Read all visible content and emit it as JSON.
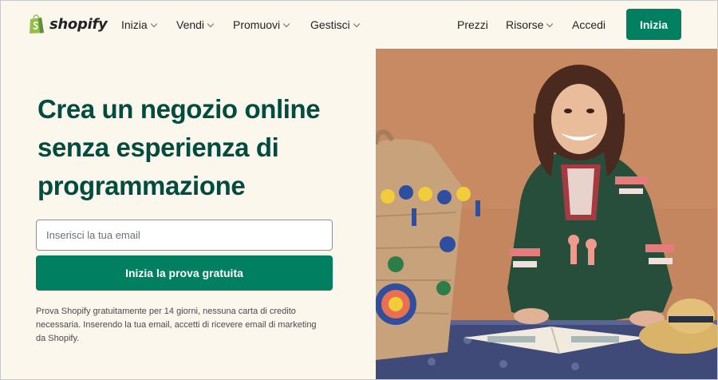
{
  "brand": {
    "name": "shopify",
    "accent": "#008060",
    "headline_color": "#004c3f",
    "background": "#fbf7ed"
  },
  "nav": {
    "left": [
      {
        "label": "Inizia",
        "dropdown": true
      },
      {
        "label": "Vendi",
        "dropdown": true
      },
      {
        "label": "Promuovi",
        "dropdown": true
      },
      {
        "label": "Gestisci",
        "dropdown": true
      }
    ],
    "right": [
      {
        "label": "Prezzi",
        "dropdown": false
      },
      {
        "label": "Risorse",
        "dropdown": true
      },
      {
        "label": "Accedi",
        "dropdown": false
      }
    ],
    "cta_label": "Inizia"
  },
  "hero": {
    "title_lines": [
      "Crea un negozio online",
      "senza esperienza di",
      "programmazione"
    ],
    "email_placeholder": "Inserisci la tua email",
    "button_label": "Inizia la prova gratuita",
    "disclaimer": "Prova Shopify gratuitamente per 14 giorni, nessuna carta di credito necessaria. Inserendo la tua email, accetti di ricevere email di marketing da Shopify."
  },
  "photo": {
    "subject": "smiling woman in embroidered dress with woven basket"
  }
}
